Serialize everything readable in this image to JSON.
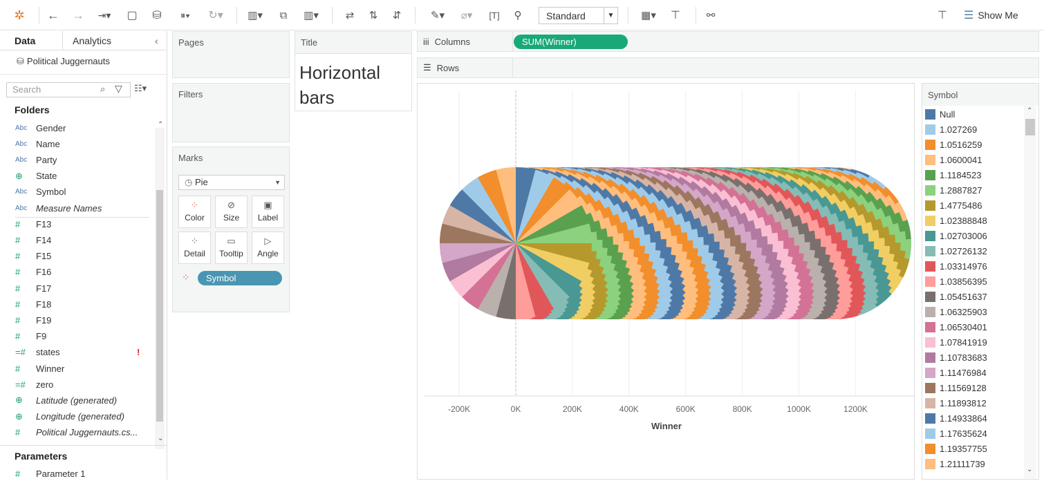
{
  "toolbar": {
    "fit_value": "Standard",
    "show_me": "Show Me",
    "icons": [
      "tableau-logo-icon",
      "back-icon",
      "forward-icon",
      "redo-icon",
      "save-icon",
      "new-datasource-icon",
      "pause-icon",
      "refresh-icon",
      "new-sheet-icon",
      "duplicate-icon",
      "clear-sheet-icon",
      "swap-icon",
      "sort-asc-icon",
      "sort-desc-icon",
      "highlight-icon",
      "group-icon",
      "label-icon",
      "pin-icon",
      "chart-icon",
      "presentation-icon",
      "share-icon"
    ]
  },
  "left_panel": {
    "tab_data": "Data",
    "tab_analytics": "Analytics",
    "data_source": "Political Juggernauts",
    "search_placeholder": "Search",
    "folders_label": "Folders",
    "dimensions": [
      {
        "type": "Abc",
        "name": "Gender"
      },
      {
        "type": "Abc",
        "name": "Name"
      },
      {
        "type": "Abc",
        "name": "Party"
      },
      {
        "type": "globe",
        "name": "State"
      },
      {
        "type": "Abc",
        "name": "Symbol"
      },
      {
        "type": "Abc",
        "name": "Measure Names"
      }
    ],
    "measures": [
      {
        "type": "#",
        "name": "F13"
      },
      {
        "type": "#",
        "name": "F14"
      },
      {
        "type": "#",
        "name": "F15"
      },
      {
        "type": "#",
        "name": "F16"
      },
      {
        "type": "#",
        "name": "F17"
      },
      {
        "type": "#",
        "name": "F18"
      },
      {
        "type": "#",
        "name": "F19"
      },
      {
        "type": "#",
        "name": "F9"
      },
      {
        "type": "=#",
        "name": "states",
        "warning": "!"
      },
      {
        "type": "#",
        "name": "Winner"
      },
      {
        "type": "=#",
        "name": "zero"
      },
      {
        "type": "globe",
        "name": "Latitude (generated)"
      },
      {
        "type": "globe",
        "name": "Longitude (generated)"
      },
      {
        "type": "#",
        "name": "Political Juggernauts.cs..."
      }
    ],
    "parameters_label": "Parameters",
    "parameters": [
      {
        "type": "#",
        "name": "Parameter 1"
      }
    ]
  },
  "cards": {
    "pages": "Pages",
    "filters": "Filters",
    "marks": "Marks",
    "mark_type": "Pie",
    "mark_buttons": [
      "Color",
      "Size",
      "Label",
      "Detail",
      "Tooltip",
      "Angle"
    ],
    "mark_pill": "Symbol"
  },
  "title_card": {
    "header": "Title",
    "text": "Horizontal bars"
  },
  "shelves": {
    "columns_label": "Columns",
    "columns_pill": "SUM(Winner)",
    "rows_label": "Rows"
  },
  "chart_data": {
    "type": "pie",
    "xlabel": "Winner",
    "x_ticks": [
      "-200K",
      "0K",
      "200K",
      "400K",
      "600K",
      "800K",
      "1000K",
      "1200K"
    ],
    "xlim": [
      -300000,
      1400000
    ],
    "grid": true,
    "note_legend": "Symbol"
  },
  "legend": {
    "title": "Symbol",
    "items": [
      {
        "label": "Null",
        "color": "#4e79a7"
      },
      {
        "label": "1.027269",
        "color": "#a0cbe8"
      },
      {
        "label": "1.0516259",
        "color": "#f28e2b"
      },
      {
        "label": "1.0600041",
        "color": "#ffbe7d"
      },
      {
        "label": "1.1184523",
        "color": "#59a14f"
      },
      {
        "label": "1.2887827",
        "color": "#8cd17d"
      },
      {
        "label": "1.4775486",
        "color": "#b6992d"
      },
      {
        "label": "1.02388848",
        "color": "#f1ce63"
      },
      {
        "label": "1.02703006",
        "color": "#499894"
      },
      {
        "label": "1.02726132",
        "color": "#86bcb6"
      },
      {
        "label": "1.03314976",
        "color": "#e15759"
      },
      {
        "label": "1.03856395",
        "color": "#ff9d9a"
      },
      {
        "label": "1.05451637",
        "color": "#79706e"
      },
      {
        "label": "1.06325903",
        "color": "#bab0ac"
      },
      {
        "label": "1.06530401",
        "color": "#d37295"
      },
      {
        "label": "1.07841919",
        "color": "#fabfd2"
      },
      {
        "label": "1.10783683",
        "color": "#b07aa1"
      },
      {
        "label": "1.11476984",
        "color": "#d4a6c8"
      },
      {
        "label": "1.11569128",
        "color": "#9d7660"
      },
      {
        "label": "1.11893812",
        "color": "#d7b5a6"
      },
      {
        "label": "1.14933864",
        "color": "#4e79a7"
      },
      {
        "label": "1.17635624",
        "color": "#a0cbe8"
      },
      {
        "label": "1.19357755",
        "color": "#f28e2b"
      },
      {
        "label": "1.21111739",
        "color": "#ffbe7d"
      }
    ]
  }
}
